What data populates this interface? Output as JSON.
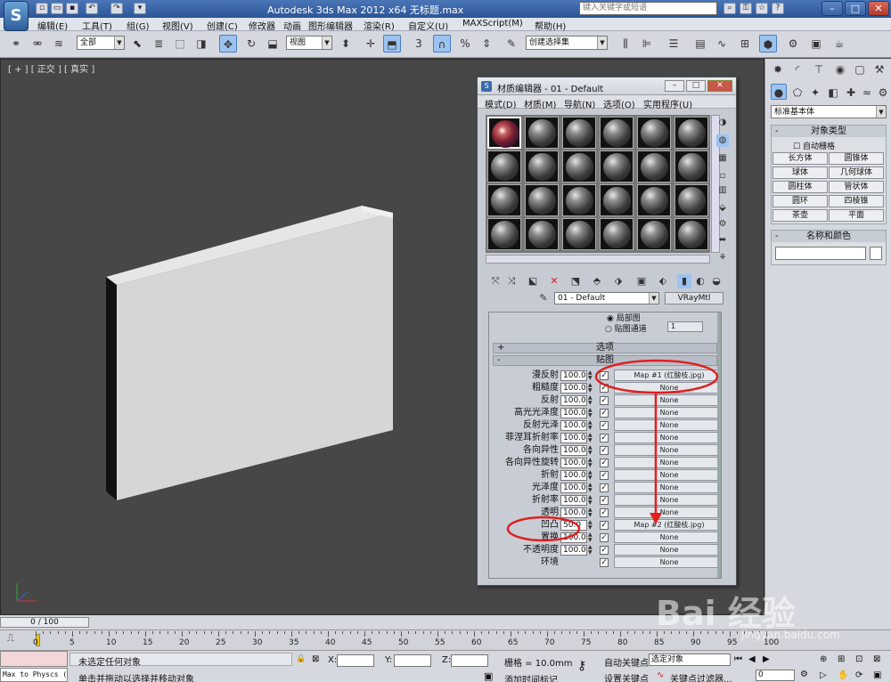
{
  "app": {
    "title": "Autodesk 3ds Max  2012 x64   无标题.max",
    "search_placeholder": "键入关键字或短语",
    "logo_glyph": "S"
  },
  "menu": [
    "编辑(E)",
    "工具(T)",
    "组(G)",
    "视图(V)",
    "创建(C)",
    "修改器",
    "动画",
    "图形编辑器",
    "渲染(R)",
    "自定义(U)",
    "MAXScript(M)",
    "帮助(H)"
  ],
  "toolbar": {
    "selection_filter": "全部",
    "ref_coord": "视图",
    "named_selection": "创建选择集"
  },
  "viewport": {
    "label": "[ + ] [ 正交 ] [ 真实 ]"
  },
  "cmdpanel": {
    "category": "标准基本体",
    "object_type_title": "对象类型",
    "auto_grid": "自动栅格",
    "object_buttons": [
      "长方体",
      "圆锥体",
      "球体",
      "几何球体",
      "圆柱体",
      "管状体",
      "圆环",
      "四棱锥",
      "茶壶",
      "平面"
    ],
    "name_color_title": "名称和颜色"
  },
  "mated": {
    "title": "材质编辑器 - 01 - Default",
    "menu": [
      "模式(D)",
      "材质(M)",
      "导航(N)",
      "选项(O)",
      "实用程序(U)"
    ],
    "material_name": "01 - Default",
    "material_type": "VRayMtl",
    "partial_option": "局部图",
    "map_channel_label": "贴图通道",
    "map_channel_value": "1",
    "options_rollout": "选项",
    "maps_rollout": "贴图",
    "maps": [
      {
        "label": "漫反射",
        "amount": "100.0",
        "map": "Map #1 (红酸枝.jpg)"
      },
      {
        "label": "粗糙度",
        "amount": "100.0",
        "map": "None"
      },
      {
        "label": "反射",
        "amount": "100.0",
        "map": "None"
      },
      {
        "label": "高光光泽度",
        "amount": "100.0",
        "map": "None"
      },
      {
        "label": "反射光泽",
        "amount": "100.0",
        "map": "None"
      },
      {
        "label": "菲涅耳折射率",
        "amount": "100.0",
        "map": "None"
      },
      {
        "label": "各向异性",
        "amount": "100.0",
        "map": "None"
      },
      {
        "label": "各向异性旋转",
        "amount": "100.0",
        "map": "None"
      },
      {
        "label": "折射",
        "amount": "100.0",
        "map": "None"
      },
      {
        "label": "光泽度",
        "amount": "100.0",
        "map": "None"
      },
      {
        "label": "折射率",
        "amount": "100.0",
        "map": "None"
      },
      {
        "label": "透明",
        "amount": "100.0",
        "map": "None"
      },
      {
        "label": "凹凸",
        "amount": "50.0",
        "map": "Map #2 (红酸枝.jpg)"
      },
      {
        "label": "置换",
        "amount": "100.0",
        "map": "None"
      },
      {
        "label": "不透明度",
        "amount": "100.0",
        "map": "None"
      },
      {
        "label": "环境",
        "amount": "",
        "map": "None"
      }
    ]
  },
  "timeline": {
    "frame_display": "0 / 100",
    "ticks": [
      "0",
      "5",
      "10",
      "15",
      "20",
      "25",
      "30",
      "35",
      "40",
      "45",
      "50",
      "55",
      "60",
      "65",
      "70",
      "75",
      "80",
      "85",
      "90",
      "95",
      "100"
    ]
  },
  "status": {
    "script_listener": "Max to Physcs (",
    "selection_status": "未选定任何对象",
    "prompt": "单击并拖动以选择并移动对象",
    "x_label": "X:",
    "y_label": "Y:",
    "z_label": "Z:",
    "grid": "栅格 = 10.0mm",
    "add_time_tag": "添加时间标记",
    "auto_key": "自动关键点",
    "auto_key_value": "选定对象",
    "set_key": "设置关键点",
    "key_filters": "关键点过滤器...",
    "current_frame": "0"
  },
  "watermark": {
    "text": "Bai 经验",
    "url": "jingyan.baidu.com"
  },
  "colors": {
    "annotation": "#e02020",
    "title_blue": "#2c5596",
    "viewport_bg": "#474747"
  }
}
